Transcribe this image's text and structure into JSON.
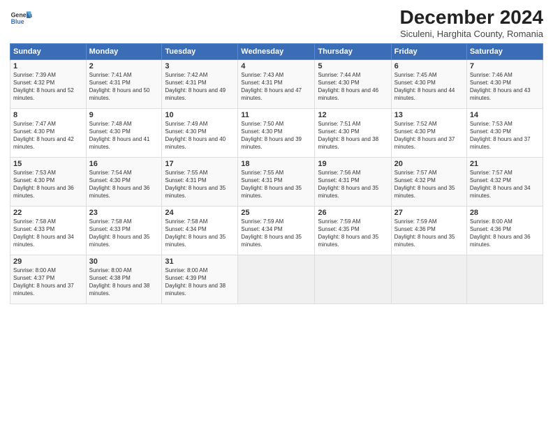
{
  "logo": {
    "line1": "General",
    "line2": "Blue"
  },
  "title": "December 2024",
  "subtitle": "Siculeni, Harghita County, Romania",
  "weekdays": [
    "Sunday",
    "Monday",
    "Tuesday",
    "Wednesday",
    "Thursday",
    "Friday",
    "Saturday"
  ],
  "weeks": [
    [
      {
        "day": "1",
        "sunrise": "Sunrise: 7:39 AM",
        "sunset": "Sunset: 4:32 PM",
        "daylight": "Daylight: 8 hours and 52 minutes."
      },
      {
        "day": "2",
        "sunrise": "Sunrise: 7:41 AM",
        "sunset": "Sunset: 4:31 PM",
        "daylight": "Daylight: 8 hours and 50 minutes."
      },
      {
        "day": "3",
        "sunrise": "Sunrise: 7:42 AM",
        "sunset": "Sunset: 4:31 PM",
        "daylight": "Daylight: 8 hours and 49 minutes."
      },
      {
        "day": "4",
        "sunrise": "Sunrise: 7:43 AM",
        "sunset": "Sunset: 4:31 PM",
        "daylight": "Daylight: 8 hours and 47 minutes."
      },
      {
        "day": "5",
        "sunrise": "Sunrise: 7:44 AM",
        "sunset": "Sunset: 4:30 PM",
        "daylight": "Daylight: 8 hours and 46 minutes."
      },
      {
        "day": "6",
        "sunrise": "Sunrise: 7:45 AM",
        "sunset": "Sunset: 4:30 PM",
        "daylight": "Daylight: 8 hours and 44 minutes."
      },
      {
        "day": "7",
        "sunrise": "Sunrise: 7:46 AM",
        "sunset": "Sunset: 4:30 PM",
        "daylight": "Daylight: 8 hours and 43 minutes."
      }
    ],
    [
      {
        "day": "8",
        "sunrise": "Sunrise: 7:47 AM",
        "sunset": "Sunset: 4:30 PM",
        "daylight": "Daylight: 8 hours and 42 minutes."
      },
      {
        "day": "9",
        "sunrise": "Sunrise: 7:48 AM",
        "sunset": "Sunset: 4:30 PM",
        "daylight": "Daylight: 8 hours and 41 minutes."
      },
      {
        "day": "10",
        "sunrise": "Sunrise: 7:49 AM",
        "sunset": "Sunset: 4:30 PM",
        "daylight": "Daylight: 8 hours and 40 minutes."
      },
      {
        "day": "11",
        "sunrise": "Sunrise: 7:50 AM",
        "sunset": "Sunset: 4:30 PM",
        "daylight": "Daylight: 8 hours and 39 minutes."
      },
      {
        "day": "12",
        "sunrise": "Sunrise: 7:51 AM",
        "sunset": "Sunset: 4:30 PM",
        "daylight": "Daylight: 8 hours and 38 minutes."
      },
      {
        "day": "13",
        "sunrise": "Sunrise: 7:52 AM",
        "sunset": "Sunset: 4:30 PM",
        "daylight": "Daylight: 8 hours and 37 minutes."
      },
      {
        "day": "14",
        "sunrise": "Sunrise: 7:53 AM",
        "sunset": "Sunset: 4:30 PM",
        "daylight": "Daylight: 8 hours and 37 minutes."
      }
    ],
    [
      {
        "day": "15",
        "sunrise": "Sunrise: 7:53 AM",
        "sunset": "Sunset: 4:30 PM",
        "daylight": "Daylight: 8 hours and 36 minutes."
      },
      {
        "day": "16",
        "sunrise": "Sunrise: 7:54 AM",
        "sunset": "Sunset: 4:30 PM",
        "daylight": "Daylight: 8 hours and 36 minutes."
      },
      {
        "day": "17",
        "sunrise": "Sunrise: 7:55 AM",
        "sunset": "Sunset: 4:31 PM",
        "daylight": "Daylight: 8 hours and 35 minutes."
      },
      {
        "day": "18",
        "sunrise": "Sunrise: 7:55 AM",
        "sunset": "Sunset: 4:31 PM",
        "daylight": "Daylight: 8 hours and 35 minutes."
      },
      {
        "day": "19",
        "sunrise": "Sunrise: 7:56 AM",
        "sunset": "Sunset: 4:31 PM",
        "daylight": "Daylight: 8 hours and 35 minutes."
      },
      {
        "day": "20",
        "sunrise": "Sunrise: 7:57 AM",
        "sunset": "Sunset: 4:32 PM",
        "daylight": "Daylight: 8 hours and 35 minutes."
      },
      {
        "day": "21",
        "sunrise": "Sunrise: 7:57 AM",
        "sunset": "Sunset: 4:32 PM",
        "daylight": "Daylight: 8 hours and 34 minutes."
      }
    ],
    [
      {
        "day": "22",
        "sunrise": "Sunrise: 7:58 AM",
        "sunset": "Sunset: 4:33 PM",
        "daylight": "Daylight: 8 hours and 34 minutes."
      },
      {
        "day": "23",
        "sunrise": "Sunrise: 7:58 AM",
        "sunset": "Sunset: 4:33 PM",
        "daylight": "Daylight: 8 hours and 35 minutes."
      },
      {
        "day": "24",
        "sunrise": "Sunrise: 7:58 AM",
        "sunset": "Sunset: 4:34 PM",
        "daylight": "Daylight: 8 hours and 35 minutes."
      },
      {
        "day": "25",
        "sunrise": "Sunrise: 7:59 AM",
        "sunset": "Sunset: 4:34 PM",
        "daylight": "Daylight: 8 hours and 35 minutes."
      },
      {
        "day": "26",
        "sunrise": "Sunrise: 7:59 AM",
        "sunset": "Sunset: 4:35 PM",
        "daylight": "Daylight: 8 hours and 35 minutes."
      },
      {
        "day": "27",
        "sunrise": "Sunrise: 7:59 AM",
        "sunset": "Sunset: 4:36 PM",
        "daylight": "Daylight: 8 hours and 35 minutes."
      },
      {
        "day": "28",
        "sunrise": "Sunrise: 8:00 AM",
        "sunset": "Sunset: 4:36 PM",
        "daylight": "Daylight: 8 hours and 36 minutes."
      }
    ],
    [
      {
        "day": "29",
        "sunrise": "Sunrise: 8:00 AM",
        "sunset": "Sunset: 4:37 PM",
        "daylight": "Daylight: 8 hours and 37 minutes."
      },
      {
        "day": "30",
        "sunrise": "Sunrise: 8:00 AM",
        "sunset": "Sunset: 4:38 PM",
        "daylight": "Daylight: 8 hours and 38 minutes."
      },
      {
        "day": "31",
        "sunrise": "Sunrise: 8:00 AM",
        "sunset": "Sunset: 4:39 PM",
        "daylight": "Daylight: 8 hours and 38 minutes."
      },
      null,
      null,
      null,
      null
    ]
  ]
}
